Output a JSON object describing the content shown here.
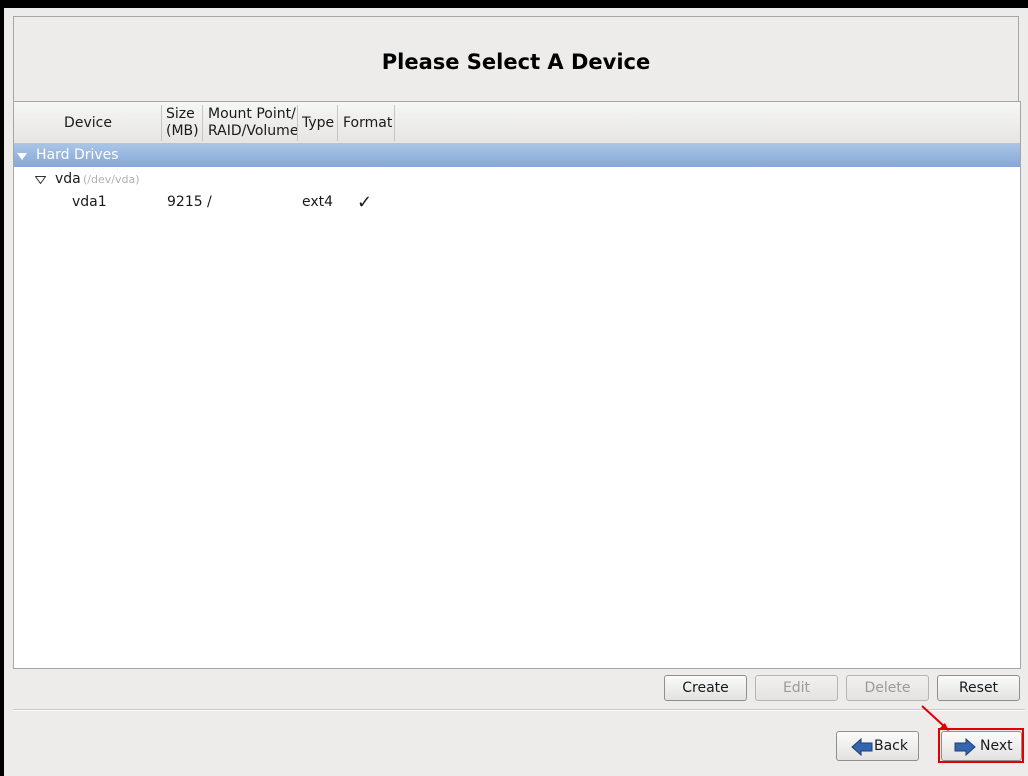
{
  "header": {
    "title": "Please Select A Device"
  },
  "table": {
    "columns": {
      "device": "Device",
      "size_line1": "Size",
      "size_line2": "(MB)",
      "mount_line1": "Mount Point/",
      "mount_line2": "RAID/Volume",
      "type": "Type",
      "format": "Format"
    },
    "group": {
      "label": "Hard Drives"
    },
    "drive": {
      "name": "vda",
      "path": "(/dev/vda)"
    },
    "partition": {
      "device": "vda1",
      "size": "9215",
      "mount": "/",
      "type": "ext4",
      "format": "✓"
    }
  },
  "actions": {
    "create": "Create",
    "edit": "Edit",
    "delete": "Delete",
    "reset": "Reset"
  },
  "navigation": {
    "back": "Back",
    "next": "Next"
  },
  "colors": {
    "selection": "#8eaedb",
    "highlight": "#e00000",
    "nav_arrow": "#2d5ea3"
  }
}
